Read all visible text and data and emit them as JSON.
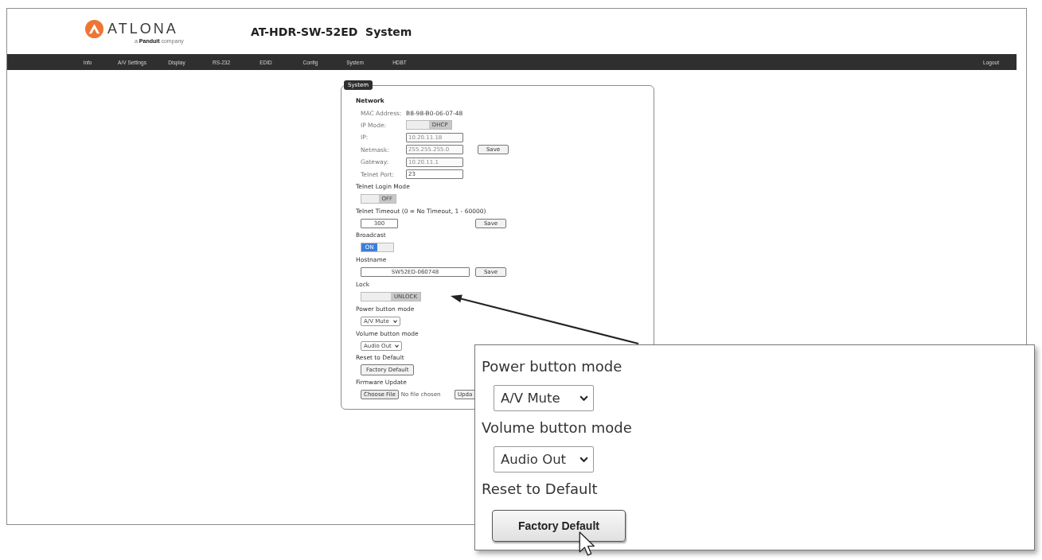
{
  "header": {
    "brand": "ATLONA",
    "tagline": "a **Panduit** company",
    "title": "AT-HDR-SW-52ED  System"
  },
  "nav": {
    "items": [
      "Info",
      "A/V Settings",
      "Display",
      "RS-232",
      "EDID",
      "Config",
      "System",
      "HDBT"
    ],
    "logout": "Logout"
  },
  "panel": {
    "legend": "System",
    "rows": [
      {
        "kind": "heading",
        "text": "Network"
      },
      {
        "kind": "info",
        "label": "MAC Address:",
        "value": "B8-98-B0-06-07-48"
      },
      {
        "kind": "switch",
        "label": "IP Mode:",
        "text": "DHCP",
        "on": false
      },
      {
        "kind": "field",
        "label": "IP:",
        "value": "10.20.11.18",
        "disabled": true
      },
      {
        "kind": "field",
        "label": "Netmask:",
        "value": "255.255.255.0",
        "disabled": true,
        "button": "Save"
      },
      {
        "kind": "field",
        "label": "Gateway:",
        "value": "10.20.11.1",
        "disabled": true
      },
      {
        "kind": "field",
        "label": "Telnet Port:",
        "value": "23",
        "disabled": false
      },
      {
        "kind": "label",
        "text": "Telnet Login Mode"
      },
      {
        "kind": "switch",
        "text": "OFF",
        "on": false
      },
      {
        "kind": "label",
        "text": "Telnet Timeout (0 = No Timeout, 1 - 60000)"
      },
      {
        "kind": "number",
        "value": "300",
        "button": "Save"
      },
      {
        "kind": "label",
        "text": "Broadcast"
      },
      {
        "kind": "switch",
        "text": "ON",
        "on": true
      },
      {
        "kind": "label",
        "text": "Hostname"
      },
      {
        "kind": "text",
        "value": "SW52ED-060748",
        "button": "Save"
      },
      {
        "kind": "label",
        "text": "Lock"
      },
      {
        "kind": "switch",
        "text": "UNLOCK",
        "on": false
      },
      {
        "kind": "label",
        "text": "Power button mode"
      },
      {
        "kind": "select",
        "value": "A/V Mute"
      },
      {
        "kind": "label",
        "text": "Volume button mode"
      },
      {
        "kind": "select",
        "value": "Audio Out"
      },
      {
        "kind": "label",
        "text": "Reset to Default"
      },
      {
        "kind": "button",
        "text": "Factory Default"
      },
      {
        "kind": "label",
        "text": "Firmware Update"
      },
      {
        "kind": "file",
        "button": "Choose File",
        "status": "No file chosen",
        "action": "Upda"
      }
    ]
  },
  "callout": {
    "rows": [
      {
        "kind": "label",
        "text": "Power button mode"
      },
      {
        "kind": "select",
        "value": "A/V Mute"
      },
      {
        "kind": "label",
        "text": "Volume button mode"
      },
      {
        "kind": "select",
        "value": "Audio Out"
      },
      {
        "kind": "label",
        "text": "Reset to Default"
      },
      {
        "kind": "button",
        "text": "Factory Default"
      }
    ]
  }
}
